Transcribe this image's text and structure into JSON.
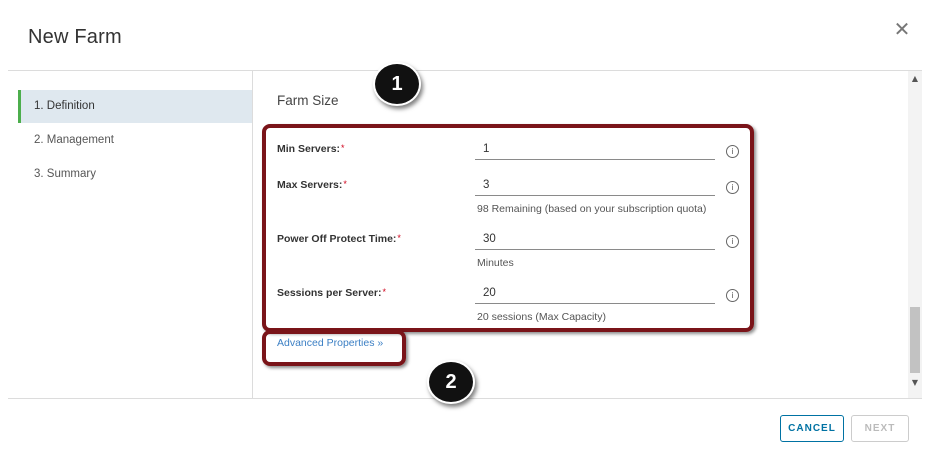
{
  "dialog": {
    "title": "New Farm",
    "close_glyph": "✕"
  },
  "sidebar": {
    "steps": [
      {
        "label": "1. Definition",
        "active": true
      },
      {
        "label": "2. Management",
        "active": false
      },
      {
        "label": "3. Summary",
        "active": false
      }
    ]
  },
  "form": {
    "section_title": "Farm Size",
    "required_mark": "*",
    "fields": [
      {
        "label": "Min Servers:",
        "value": "1",
        "helper": ""
      },
      {
        "label": "Max Servers:",
        "value": "3",
        "helper": "98 Remaining (based on your subscription quota)"
      },
      {
        "label": "Power Off Protect Time:",
        "value": "30",
        "helper": "Minutes"
      },
      {
        "label": "Sessions per Server:",
        "value": "20",
        "helper": "20 sessions (Max Capacity)"
      }
    ],
    "info_glyph": "i",
    "advanced_link": "Advanced Properties »"
  },
  "scrollbar": {
    "up_glyph": "▲",
    "down_glyph": "▼"
  },
  "footer": {
    "cancel_label": "CANCEL",
    "next_label": "NEXT"
  },
  "callouts": {
    "badge_1": "1",
    "badge_2": "2"
  },
  "colors": {
    "accent_blue": "#0072a3",
    "link_blue": "#3b7fc4",
    "active_step_bg": "#dfe8ef",
    "active_step_border": "#4cae4c",
    "callout_border": "#7a1419",
    "required": "#d0021b"
  }
}
